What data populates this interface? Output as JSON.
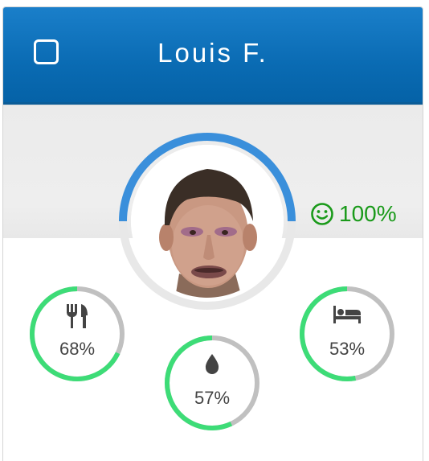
{
  "card": {
    "name": "Louis F.",
    "selected": false
  },
  "happiness": {
    "value": 100,
    "label": "100%",
    "icon": "smiley-icon",
    "color": "#1a9a1a"
  },
  "needs": [
    {
      "key": "hunger",
      "icon": "fork-knife-icon",
      "value": 68,
      "label": "68%"
    },
    {
      "key": "thirst",
      "icon": "water-drop-icon",
      "value": 57,
      "label": "57%"
    },
    {
      "key": "sleep",
      "icon": "bed-icon",
      "value": 53,
      "label": "53%"
    }
  ],
  "colors": {
    "header": "#0a6bb3",
    "need_ring": "#3ddc77",
    "ring_track": "#c0c0c0",
    "avatar_ring": "#3a8fdb"
  }
}
